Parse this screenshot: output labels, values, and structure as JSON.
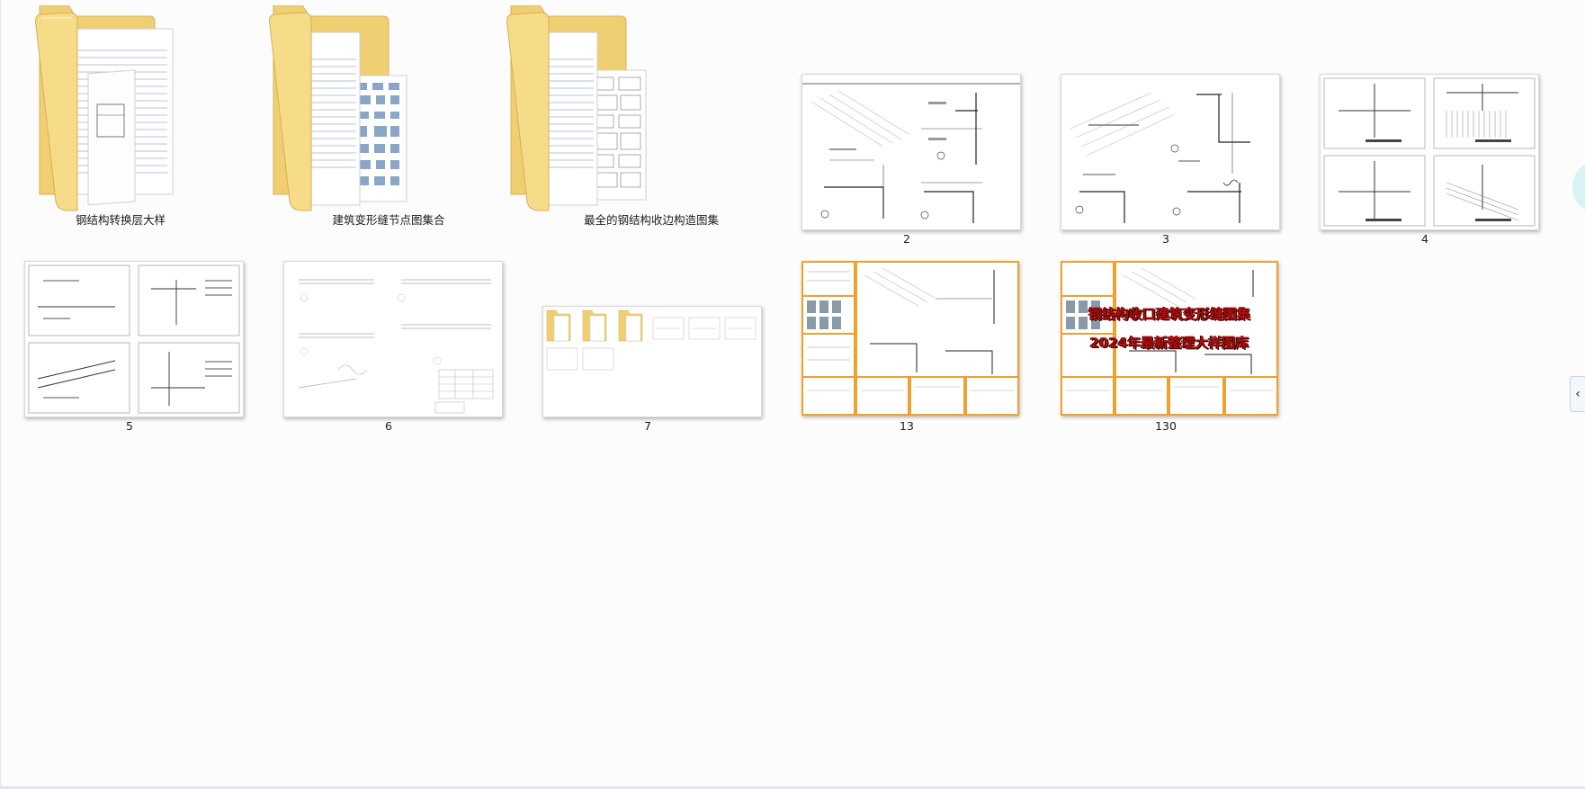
{
  "items": [
    {
      "type": "folder",
      "label": "钢结构转换层大样"
    },
    {
      "type": "folder",
      "label": "建筑变形缝节点图集合"
    },
    {
      "type": "folder",
      "label": "最全的钢结构收边构造图集"
    },
    {
      "type": "image",
      "label": "2"
    },
    {
      "type": "image",
      "label": "3"
    },
    {
      "type": "image",
      "label": "4"
    },
    {
      "type": "image",
      "label": "5"
    },
    {
      "type": "image",
      "label": "6"
    },
    {
      "type": "image",
      "label": "7"
    },
    {
      "type": "image",
      "label": "13"
    },
    {
      "type": "image",
      "label": "130"
    }
  ],
  "overlay": {
    "line1": "钢结构收口建筑变形缝图集",
    "line2": "2024年最新整理大样图库"
  },
  "icons": {
    "collapse": "chevron-left-icon",
    "folder": "folder-icon"
  },
  "colors": {
    "folder_yellow": "#f3d47a",
    "accent_orange": "#f0a12c",
    "overlay_red": "#b40c0c"
  }
}
